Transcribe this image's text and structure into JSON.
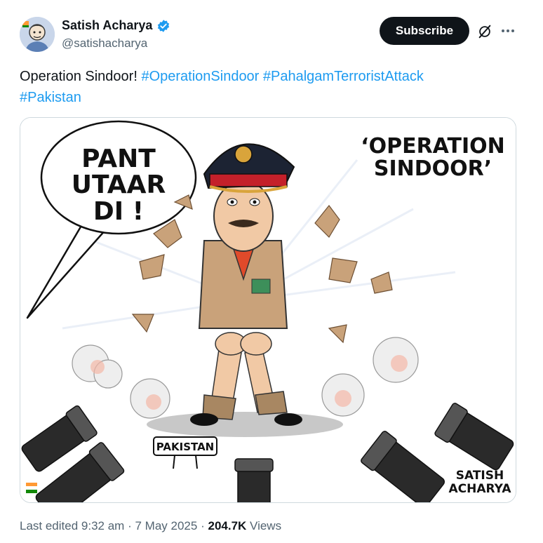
{
  "author": {
    "display_name": "Satish Acharya",
    "handle": "@satishacharya",
    "verified": true,
    "avatar_icon": "cartoon-avatar"
  },
  "actions": {
    "subscribe_label": "Subscribe",
    "grok_icon": "grok-icon",
    "more_icon": "more-icon"
  },
  "tweet": {
    "text": "Operation Sindoor!",
    "hashtags": [
      "#OperationSindoor",
      "#PahalgamTerroristAttack",
      "#Pakistan"
    ]
  },
  "image": {
    "speech_bubble": [
      "PANT",
      "UTAAR",
      "DI !"
    ],
    "title": [
      "‘OPERATION",
      "SINDOOR’"
    ],
    "sign": "PAKISTAN",
    "signature": [
      "SATISH",
      "ACHARYA"
    ]
  },
  "meta": {
    "edited_label": "Last edited",
    "time": "9:32 am",
    "date": "7 May 2025",
    "views_count": "204.7K",
    "views_label": "Views"
  },
  "colors": {
    "hashtag": "#1d9bf0",
    "subscribe_bg": "#0f1419",
    "verified": "#1d9bf0",
    "secondary_text": "#536471"
  }
}
